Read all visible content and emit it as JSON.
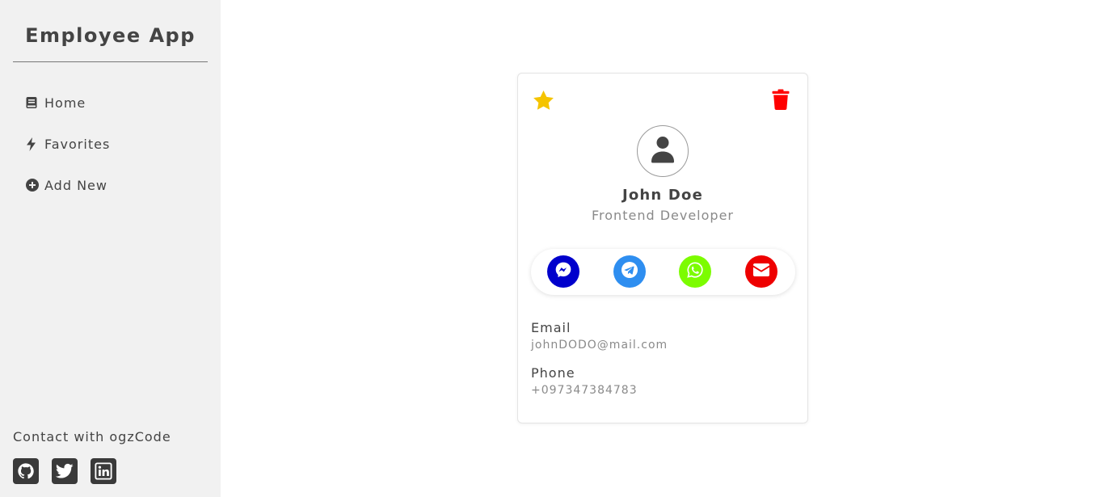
{
  "app": {
    "title": "Employee App"
  },
  "nav": {
    "items": [
      {
        "label": "Home",
        "icon": "book-icon"
      },
      {
        "label": "Favorites",
        "icon": "bolt-icon"
      },
      {
        "label": "Add New",
        "icon": "plus-circle-icon"
      }
    ]
  },
  "footer": {
    "contact_label": "Contact with ogzCode",
    "socials": [
      "github-icon",
      "twitter-icon",
      "linkedin-icon"
    ]
  },
  "employee": {
    "name": "John Doe",
    "title": "Frontend Developer",
    "email_label": "Email",
    "email": "johnDODO@mail.com",
    "phone_label": "Phone",
    "phone": "+097347384783"
  },
  "colors": {
    "favorite": "#f5c400",
    "delete": "#ff0000",
    "messenger": "#0000cc",
    "telegram": "#2e8ef0",
    "whatsapp": "#7cfc00",
    "mail": "#ee0000"
  }
}
